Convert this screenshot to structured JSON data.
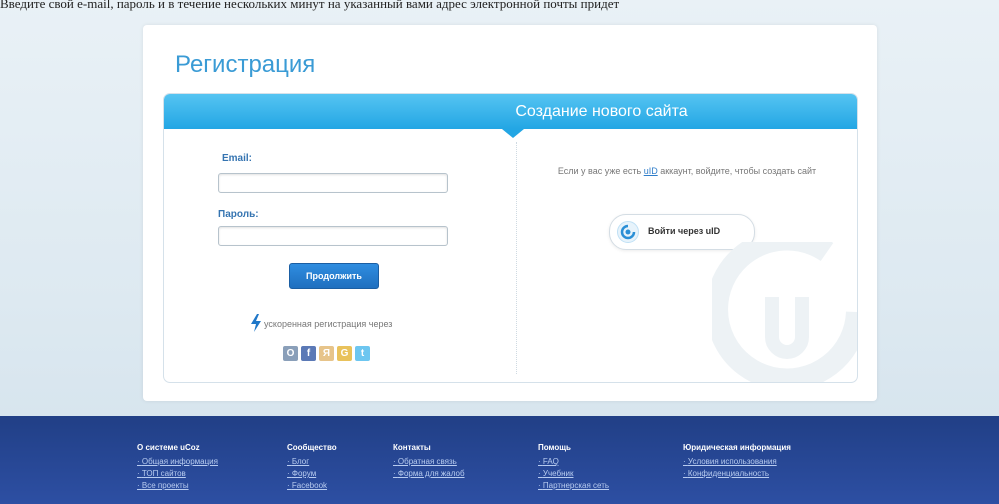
{
  "top_caption": "Введите свой e-mail, пароль и в течение нескольких минут на указанный вами адрес электронной почты придет",
  "title": "Регистрация",
  "panel": {
    "header": "Создание нового сайта",
    "email_label": "Email:",
    "email_value": "",
    "password_label": "Пароль:",
    "password_value": "",
    "continue_button": "Продолжить",
    "fast_registration": "ускоренная регистрация через",
    "social_icons": [
      "odnoklassniki-icon",
      "facebook-icon",
      "yandex-icon",
      "google-icon",
      "twitter-icon"
    ],
    "social_glyphs": [
      "О",
      "f",
      "Я",
      "G",
      "t"
    ],
    "social_colors": [
      "#8a9fb9",
      "#5b79b6",
      "#e7c48a",
      "#e9c25b",
      "#6dc6f0"
    ]
  },
  "uid": {
    "info_before": "Если у вас уже есть ",
    "info_link": "uID",
    "info_after": " аккаунт, войдите, чтобы создать сайт",
    "button": "Войти через uID"
  },
  "colors": {
    "accent": "#3a9bd5",
    "header_blue": "#23a6e4",
    "button_blue": "#2f8de0",
    "footer_blue": "#213f86"
  },
  "footer": [
    {
      "heading": "О системе uCoz",
      "links": [
        "Общая информация",
        "ТОП сайтов",
        "Все проекты"
      ]
    },
    {
      "heading": "Сообщество",
      "links": [
        "Блог",
        "Форум",
        "Facebook"
      ]
    },
    {
      "heading": "Контакты",
      "links": [
        "Обратная связь",
        "Форма для жалоб"
      ]
    },
    {
      "heading": "Помощь",
      "links": [
        "FAQ",
        "Учебник",
        "Партнерская сеть"
      ]
    },
    {
      "heading": "Юридическая информация",
      "links": [
        "Условия использования",
        "Конфиденциальность"
      ]
    }
  ]
}
